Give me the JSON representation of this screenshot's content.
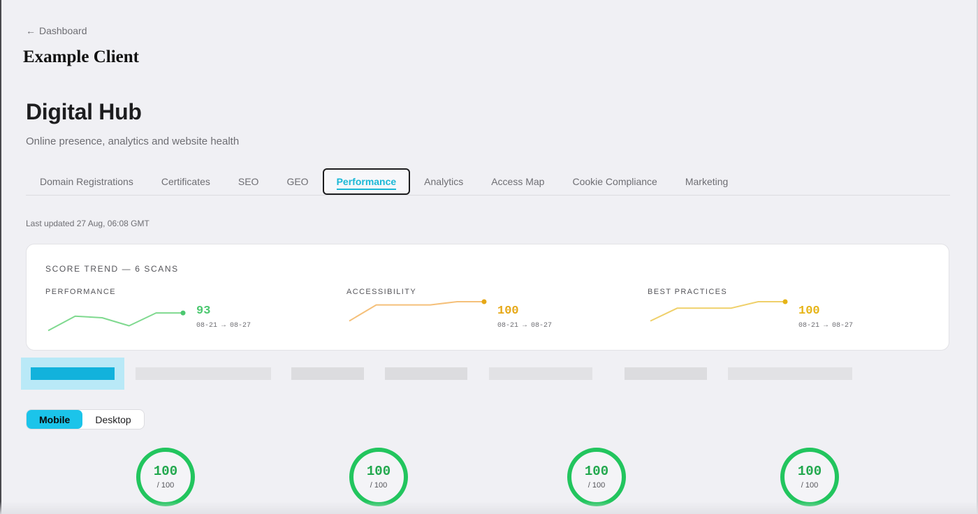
{
  "nav": {
    "back_arrow_icon": "arrow-left-icon",
    "back_label": "Dashboard"
  },
  "client": {
    "name": "Example Client"
  },
  "page": {
    "title": "Digital Hub",
    "subtitle": "Online presence, analytics and website health"
  },
  "tabs": [
    {
      "label": "Domain Registrations",
      "active": false
    },
    {
      "label": "Certificates",
      "active": false
    },
    {
      "label": "SEO",
      "active": false
    },
    {
      "label": "GEO",
      "active": false
    },
    {
      "label": "Performance",
      "active": true
    },
    {
      "label": "Analytics",
      "active": false
    },
    {
      "label": "Access Map",
      "active": false
    },
    {
      "label": "Cookie Compliance",
      "active": false
    },
    {
      "label": "Marketing",
      "active": false
    }
  ],
  "status": {
    "last_updated": "Last updated 27 Aug, 06:08 GMT"
  },
  "trend": {
    "heading": "SCORE TREND — 6 SCANS",
    "metrics": [
      {
        "label": "PERFORMANCE",
        "value": "93",
        "range": "08-21 → 08-27",
        "color": "#4cc870",
        "line_color": "#7fd98f",
        "scores": [
          82,
          91,
          90,
          85,
          93,
          93
        ]
      },
      {
        "label": "ACCESSIBILITY",
        "value": "100",
        "range": "08-21 → 08-27",
        "color": "#e6a817",
        "line_color": "#f5c07a",
        "scores": [
          88,
          98,
          98,
          98,
          100,
          100
        ]
      },
      {
        "label": "BEST PRACTICES",
        "value": "100",
        "range": "08-21 → 08-27",
        "color": "#e6b417",
        "line_color": "#efd06a",
        "scores": [
          88,
          96,
          96,
          96,
          100,
          100
        ]
      }
    ]
  },
  "device_toggle": {
    "options": [
      "Mobile",
      "Desktop"
    ],
    "selected": "Mobile",
    "accent": "#1bc4ea"
  },
  "scores": [
    {
      "score": "100",
      "max": "/ 100",
      "color": "#22c55e"
    },
    {
      "score": "100",
      "max": "/ 100",
      "color": "#22c55e"
    },
    {
      "score": "100",
      "max": "/ 100",
      "color": "#22c55e"
    },
    {
      "score": "100",
      "max": "/ 100",
      "color": "#22c55e"
    }
  ]
}
